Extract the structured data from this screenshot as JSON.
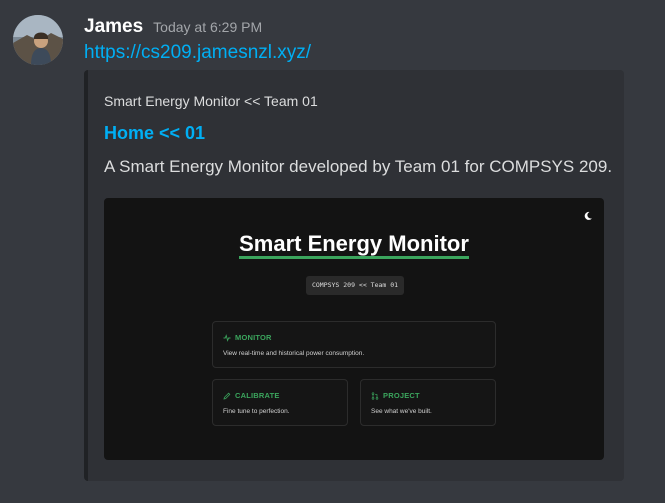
{
  "message": {
    "username": "James",
    "timestamp": "Today at 6:29 PM",
    "link": "https://cs209.jamesnzl.xyz/"
  },
  "embed": {
    "provider": "Smart Energy Monitor << Team 01",
    "title": "Home << 01",
    "description": "A Smart Energy Monitor developed by Team 01 for COMPSYS 209."
  },
  "preview": {
    "site_title": "Smart Energy Monitor",
    "code_badge": "COMPSYS 209 << Team 01",
    "cards": {
      "monitor": {
        "icon": "pulse-icon",
        "title": "MONITOR",
        "text": "View real-time and historical power consumption."
      },
      "calibrate": {
        "icon": "pencil-icon",
        "title": "CALIBRATE",
        "text": "Fine tune to perfection."
      },
      "project": {
        "icon": "git-pull-request-icon",
        "title": "PROJECT",
        "text": "See what we've built."
      }
    },
    "theme_icon": "moon-icon"
  },
  "colors": {
    "background": "#36393f",
    "embed_background": "#2f3136",
    "link": "#00aff4",
    "accent_green": "#3ba55d",
    "preview_background": "#131313"
  }
}
